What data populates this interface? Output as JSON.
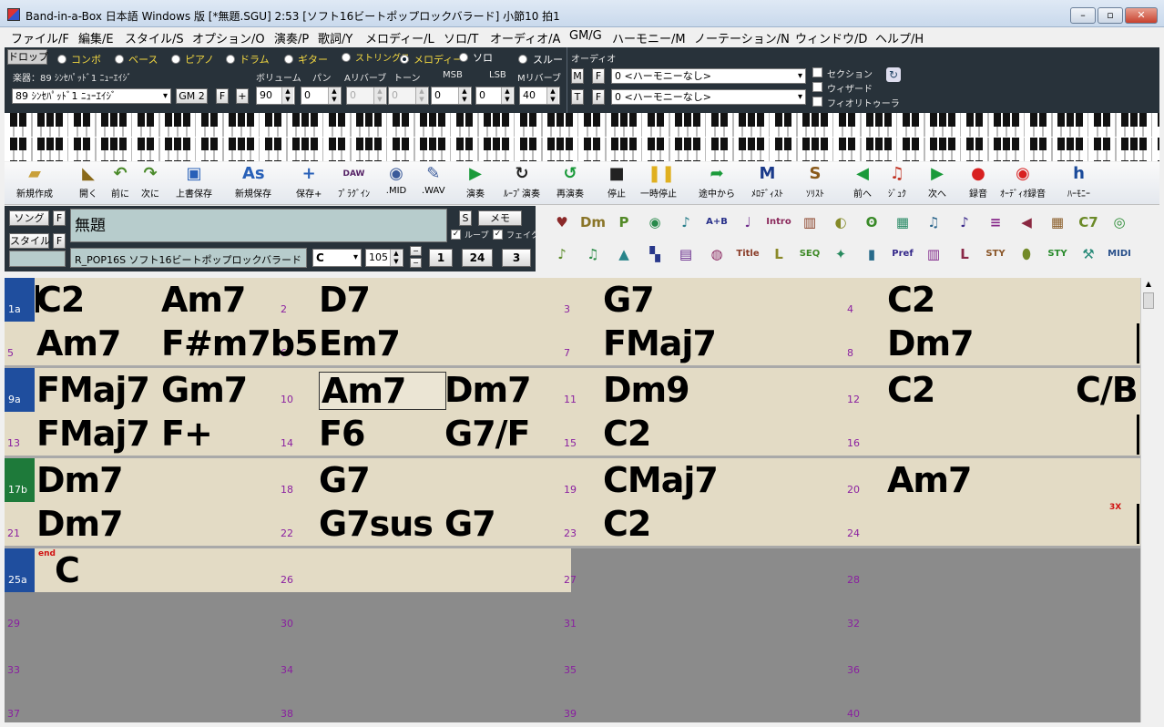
{
  "window": {
    "title": "Band-in-a-Box 日本語 Windows 版  [*無題.SGU]   2:53  [ソフト16ビートポップロックバラード]  小節10 拍1",
    "min": "–",
    "max": "▫",
    "close": "✕"
  },
  "menu": [
    "ファイル/F",
    "編集/E",
    "スタイル/S",
    "オプション/O",
    "演奏/P",
    "歌詞/Y",
    "メロディー/L",
    "ソロ/T",
    "オーディオ/A",
    "GM/G",
    "ハーモニー/M",
    "ノーテーション/N",
    "ウィンドウ/D",
    "ヘルプ/H"
  ],
  "mixer": {
    "drop": "ドロップ",
    "tracks": [
      {
        "label": "コンボ",
        "on": false
      },
      {
        "label": "ベース",
        "on": false
      },
      {
        "label": "ピアノ",
        "on": false
      },
      {
        "label": "ドラム",
        "on": false
      },
      {
        "label": "ギター",
        "on": false
      },
      {
        "label": "ストリングス",
        "on": false
      },
      {
        "label": "メロディー",
        "on": true
      },
      {
        "label": "ソロ",
        "on": false
      },
      {
        "label": "スルー",
        "on": false
      }
    ],
    "instrument_label": "楽器：89 ｼﾝｾﾊﾟｯﾄﾞ1 ﾆｭｰｴｲｼﾞ",
    "instrument": "89 ｼﾝｾﾊﾟｯﾄﾞ1 ﾆｭｰｴｲｼﾞ",
    "gm": "GM 2",
    "f": "F",
    "plus": "+",
    "cols": [
      "ボリューム",
      "パン",
      "Aリバーブ",
      "トーン",
      "MSB",
      "LSB",
      "Mリバーブ"
    ],
    "values": [
      "90",
      "0",
      "0",
      "0",
      "0",
      "0",
      "40"
    ],
    "audio": "オーディオ",
    "m": "M",
    "t": "T",
    "harmony1": "0 <ハーモニーなし>",
    "harmony2": "0 <ハーモニーなし>",
    "opts": [
      "セクション",
      "ウィザード",
      "フィオリトゥーラ"
    ]
  },
  "toolbar": [
    {
      "label": "新規作成",
      "icon": "new-file-icon",
      "glyph": "▰",
      "color": "#c9a03a"
    },
    {
      "label": "開く",
      "icon": "open-folder-icon",
      "glyph": "◣",
      "color": "#8a6a1a"
    },
    {
      "label": "前に",
      "icon": "prev-song-icon",
      "glyph": "↶",
      "color": "#4a8a2a"
    },
    {
      "label": "次に",
      "icon": "next-song-icon",
      "glyph": "↷",
      "color": "#4a8a2a"
    },
    {
      "label": "上書保存",
      "icon": "save-icon",
      "glyph": "▣",
      "color": "#2860b8"
    },
    {
      "label": "新規保存",
      "icon": "save-as-icon",
      "glyph": "As",
      "color": "#2860b8"
    },
    {
      "label": "保存+",
      "icon": "save-plus-icon",
      "glyph": "+",
      "color": "#2860b8"
    },
    {
      "label": "ﾌﾟﾗｸﾞｲﾝ",
      "icon": "daw-plugin-icon",
      "glyph": "DAW",
      "color": "#552266"
    },
    {
      "label": ".MID",
      "icon": "midi-file-icon",
      "glyph": "◉",
      "color": "#3a5a9a"
    },
    {
      "label": ".WAV",
      "icon": "wav-file-icon",
      "glyph": "✎",
      "color": "#3a5a9a"
    },
    {
      "label": "演奏",
      "icon": "play-icon",
      "glyph": "▶",
      "color": "#1a9a3a"
    },
    {
      "label": "ﾙｰﾌﾟ演奏",
      "icon": "loop-play-icon",
      "glyph": "↻",
      "color": "#222"
    },
    {
      "label": "再演奏",
      "icon": "replay-icon",
      "glyph": "↺",
      "color": "#1a9a3a"
    },
    {
      "label": "停止",
      "icon": "stop-icon",
      "glyph": "■",
      "color": "#222"
    },
    {
      "label": "一時停止",
      "icon": "pause-icon",
      "glyph": "❚❚",
      "color": "#e0b020"
    },
    {
      "label": "途中から",
      "icon": "play-from-icon",
      "glyph": "➦",
      "color": "#1a9a3a"
    },
    {
      "label": "ﾒﾛﾃﾞｨｽﾄ",
      "icon": "melodist-icon",
      "glyph": "M",
      "color": "#1a3a8a"
    },
    {
      "label": "ｿﾘｽﾄ",
      "icon": "soloist-icon",
      "glyph": "S",
      "color": "#8a5a1a"
    },
    {
      "label": "前へ",
      "icon": "previous-arrow-icon",
      "glyph": "◀",
      "color": "#1a9a3a"
    },
    {
      "label": "ｼﾞｭｸ",
      "icon": "jukebox-icon",
      "glyph": "♫",
      "color": "#c03020"
    },
    {
      "label": "次へ",
      "icon": "next-arrow-icon",
      "glyph": "▶",
      "color": "#1a9a3a"
    },
    {
      "label": "録音",
      "icon": "record-icon",
      "glyph": "●",
      "color": "#d82020"
    },
    {
      "label": "ｵｰﾃﾞｨｵ録音",
      "icon": "audio-record-icon",
      "glyph": "◉",
      "color": "#d82020"
    },
    {
      "label": "ﾊｰﾓﾆｰ",
      "icon": "harmony-icon",
      "glyph": "h",
      "color": "#1a4a9a"
    }
  ],
  "song": {
    "song_btn": "ソング",
    "style_btn": "スタイル",
    "f": "F",
    "title": "無題",
    "s": "S",
    "memo": "メモ",
    "loop": "ループ",
    "fake": "フェイク",
    "style": "R_POP16S ソフト16ビートポップロックバラード",
    "key": "C",
    "tempo": "105",
    "bar1": "1",
    "bar2": "24",
    "bar3": "3"
  },
  "grid_icons": [
    [
      "guitar-heart-icon",
      "chord-dm-icon",
      "p-icon",
      "record-disc-icon",
      "sax-icon",
      "a-plus-b-icon",
      "guitar-icon",
      "intro-icon",
      "piano-keys-icon",
      "lemon-icon",
      "ear-icon",
      "waveform-icon",
      "notes-g7-icon",
      "note-icon",
      "list-icon",
      "reverse-icon",
      "grid-icon",
      "c7-icon",
      "cd-icon"
    ],
    [
      "eighth-note-icon",
      "green-note-icon",
      "tube-icon",
      "audio-wave-icon",
      "printer-icon",
      "drum-icon",
      "title-icon",
      "l-icon",
      "seq-icon",
      "player-icon",
      "bars-icon",
      "pref-icon",
      "mixer-icon",
      "lyrics-icon",
      "sty-icon",
      "pill-icon",
      "sty-edit-icon",
      "tools-icon",
      "midi-icon"
    ]
  ],
  "grid_glyphs": [
    [
      "♥",
      "Dm",
      "P",
      "◉",
      "♪",
      "A+B",
      "♩",
      "Intro",
      "▥",
      "◐",
      "ʘ",
      "▦",
      "♫",
      "♪",
      "≡",
      "◀",
      "▦",
      "C7",
      "◎"
    ],
    [
      "♪",
      "♫",
      "▲",
      "▚",
      "▤",
      "◍",
      "Title",
      "L",
      "SEQ",
      "✦",
      "▮",
      "Pref",
      "▥",
      "L",
      "STY",
      "⬮",
      "STY",
      "⚒",
      "MIDI"
    ]
  ],
  "sheet": {
    "rows": [
      {
        "section": "1a",
        "bars": [
          "",
          "2",
          "3",
          "4"
        ],
        "chords": [
          [
            "C2",
            "Am7"
          ],
          [
            "D7"
          ],
          [
            "G7"
          ],
          [
            "C2"
          ]
        ]
      },
      {
        "section": "",
        "bars": [
          "5",
          "6",
          "7",
          "8"
        ],
        "chords": [
          [
            "Am7",
            "F#m7b5"
          ],
          [
            "Em7"
          ],
          [
            "FMaj7"
          ],
          [
            "Dm7"
          ]
        ]
      },
      {
        "section": "9a",
        "bars": [
          "",
          "10",
          "11",
          "12"
        ],
        "chords": [
          [
            "FMaj7",
            "Gm7"
          ],
          [
            "Am7",
            "Dm7"
          ],
          [
            "Dm9"
          ],
          [
            "C2",
            "C/B"
          ]
        ]
      },
      {
        "section": "",
        "bars": [
          "13",
          "14",
          "15",
          "16"
        ],
        "chords": [
          [
            "FMaj7",
            "F+"
          ],
          [
            "F6",
            "G7/F"
          ],
          [
            "C2"
          ],
          []
        ]
      },
      {
        "section": "17b",
        "bars": [
          "",
          "18",
          "19",
          "20"
        ],
        "chords": [
          [
            "Dm7"
          ],
          [
            "G7"
          ],
          [
            "CMaj7"
          ],
          [
            "Am7"
          ]
        ]
      },
      {
        "section": "",
        "bars": [
          "21",
          "22",
          "23",
          "24"
        ],
        "chords": [
          [
            "Dm7"
          ],
          [
            "G7sus",
            "G7"
          ],
          [
            "C2"
          ],
          []
        ]
      },
      {
        "section": "25a",
        "bars": [
          "",
          "26",
          "27",
          "28"
        ],
        "chords": [
          [
            "C"
          ],
          [],
          [],
          []
        ]
      },
      {
        "section": "",
        "bars": [
          "29",
          "30",
          "31",
          "32"
        ],
        "chords": [
          [],
          [],
          [],
          []
        ]
      },
      {
        "section": "",
        "bars": [
          "33",
          "34",
          "35",
          "36"
        ],
        "chords": [
          [],
          [],
          [],
          []
        ]
      },
      {
        "section": "",
        "bars": [
          "37",
          "38",
          "39",
          "40"
        ],
        "chords": [
          [],
          [],
          [],
          []
        ]
      }
    ],
    "end_label": "end",
    "repeat_label": "3X",
    "section_colors": {
      "a": "#1f4e9e",
      "b": "#1e7a3a"
    }
  }
}
